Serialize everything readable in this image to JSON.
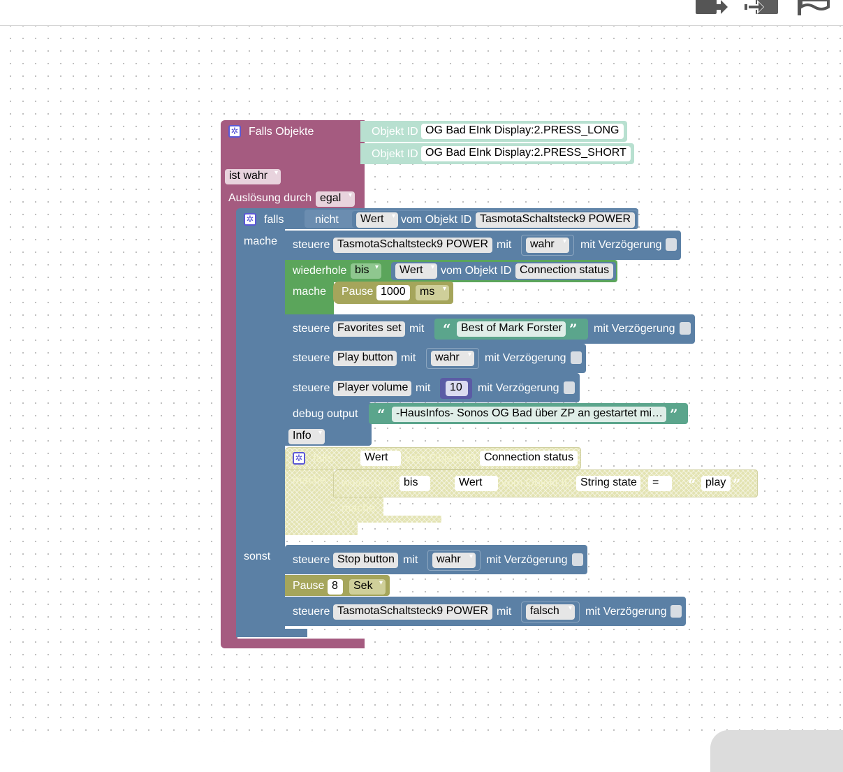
{
  "colors": {
    "trigger": "#a55b80",
    "logic": "#5b80a5",
    "loop": "#5ba55b",
    "timeout": "#a5a55b",
    "text": "#5ba58c",
    "objectid": "#b8e0d0",
    "disabled": "#e3e3b2"
  },
  "toolbar": {
    "icons": [
      "export-icon",
      "import-icon",
      "flag-icon"
    ]
  },
  "trigger": {
    "title": "Falls Objekte",
    "object_label": "Objekt ID",
    "objects": [
      "OG Bad EInk Display:2.PRESS_LONG",
      "OG Bad EInk Display:2.PRESS_SHORT"
    ],
    "condition": "ist wahr",
    "trigger_label": "Auslösung durch",
    "trigger_value": "egal"
  },
  "if_block": {
    "falls": "falls",
    "nicht": "nicht",
    "wert": "Wert",
    "vom_objekt": "vom Objekt ID",
    "object": "TasmotaSchaltsteck9 POWER",
    "mache": "mache",
    "sonst": "sonst"
  },
  "labels": {
    "steuere": "steuere",
    "mit": "mit",
    "mit_verzoegerung": "mit Verzögerung",
    "wiederhole": "wiederhole",
    "bis": "bis",
    "mache": "mache",
    "pause": "Pause",
    "debug_output": "debug output",
    "falls": "falls",
    "wert": "Wert",
    "vom_objekt": "vom Objekt ID"
  },
  "statements": {
    "s1": {
      "object": "TasmotaSchaltsteck9 POWER",
      "value": "wahr"
    },
    "repeat1": {
      "mode": "bis",
      "object": "Connection status",
      "pause_value": "1000",
      "pause_unit": "ms"
    },
    "s2": {
      "object": "Favorites set",
      "value": "Best of Mark Forster"
    },
    "s3": {
      "object": "Play button",
      "value": "wahr"
    },
    "s4": {
      "object": "Player volume",
      "value": "10"
    },
    "debug": {
      "text": "-HausInfos- Sonos OG Bad über ZP an gestartet mi…",
      "level": "Info"
    },
    "disabled_if": {
      "object": "Connection status",
      "repeat_mode": "bis",
      "repeat_object": "String state",
      "operator": "=",
      "compare_value": "play"
    },
    "else1": {
      "object": "Stop button",
      "value": "wahr"
    },
    "pause2": {
      "value": "8",
      "unit": "Sek"
    },
    "else2": {
      "object": "TasmotaSchaltsteck9 POWER",
      "value": "falsch"
    }
  }
}
